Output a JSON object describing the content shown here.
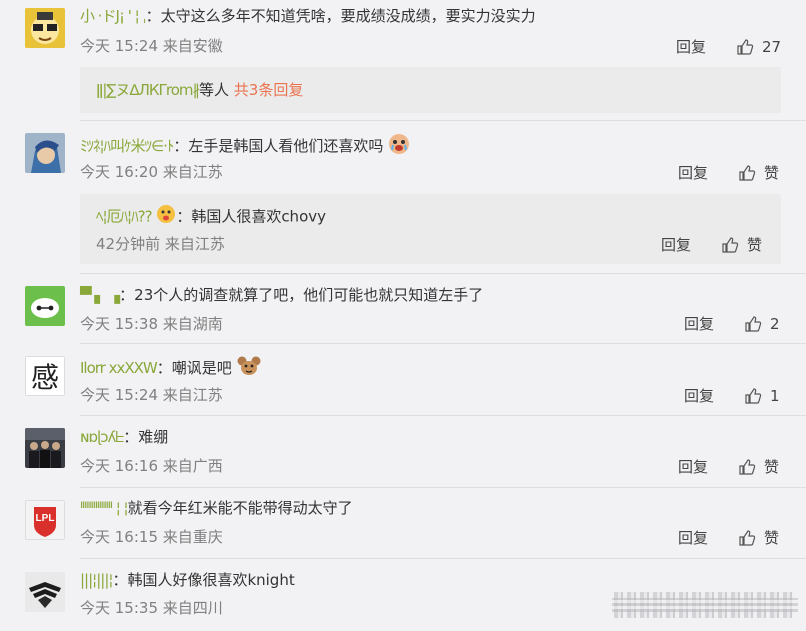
{
  "comments": [
    {
      "username": "小 ·ドJ¡ ' ¦ ˌ",
      "text": "：太守这么多年不知道凭啥，要成绩没成绩，要实力没实力",
      "time": "今天 15:24 来自安徽",
      "reply_label": "回复",
      "like_label": "27",
      "sub": {
        "users": "ǁ|∑ヌ∆ЛКΓrom∦",
        "suffix": "等人",
        "link": "共3条回复"
      }
    },
    {
      "username": "ﾐﾂﾈ¦ﾊ叫ｹ米ﾂ∈·ﾄ",
      "text": "：左手是韩国人看他们还喜欢吗",
      "time": "今天 16:20 来自江苏",
      "reply_label": "回复",
      "like_label": "赞",
      "sub": {
        "username": "ﾍ¦厄ﾊ¦ﾊ??",
        "text": "：韩国人很喜欢chovy",
        "time": "42分钟前 来自江苏",
        "reply_label": "回复",
        "like_label": "赞"
      }
    },
    {
      "username": "▀  ▖     ▗",
      "text": "：23个人的调查就算了吧，他们可能也就只知道左手了",
      "time": "今天 15:38 来自湖南",
      "reply_label": "回复",
      "like_label": "2"
    },
    {
      "username": "Ilorr xxXXW",
      "text": "：嘲讽是吧",
      "time": "今天 15:24 来自江苏",
      "reply_label": "回复",
      "like_label": "1",
      "avatar_text": "感"
    },
    {
      "username": "ɴɒɭɔʎᖶ",
      "text": "：难绷",
      "time": "今天 16:16 来自广西",
      "reply_label": "回复",
      "like_label": "赞"
    },
    {
      "username": "ᑊᑊᑊᑊᑊᑊᑊᑊᑊᑊᑊᑊᑊᑊᑊᑊᑊ ¦ ¦",
      "text": "就看今年红米能不能带得动太守了",
      "time": "今天 16:15 来自重庆",
      "reply_label": "回复",
      "like_label": "赞",
      "avatar_text": "LPL"
    },
    {
      "username": "|||¦|||¦",
      "text": "：韩国人好像很喜欢knight",
      "time": "今天 15:35 来自四川"
    }
  ],
  "colors": {
    "accent_link": "#eb7350",
    "username": "#8aa83a",
    "meta": "#808080"
  }
}
